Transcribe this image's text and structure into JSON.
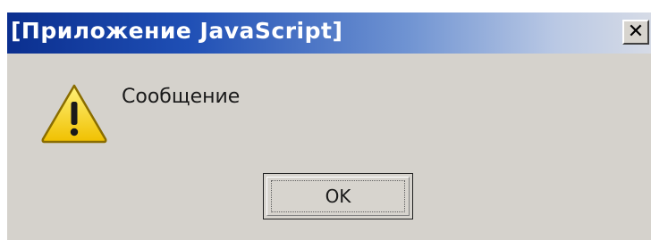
{
  "window": {
    "title": "[Приложение JavaScript]",
    "close_symbol": "✕"
  },
  "dialog": {
    "icon": "warning-icon",
    "message": "Сообщение",
    "ok_label": "OK"
  },
  "colors": {
    "titlebar_start": "#0b2f8f",
    "titlebar_end": "#d6dbe6",
    "dialog_background": "#d5d2cc",
    "warning_fill": "#f5d21a",
    "warning_outline": "#8a6d00"
  }
}
